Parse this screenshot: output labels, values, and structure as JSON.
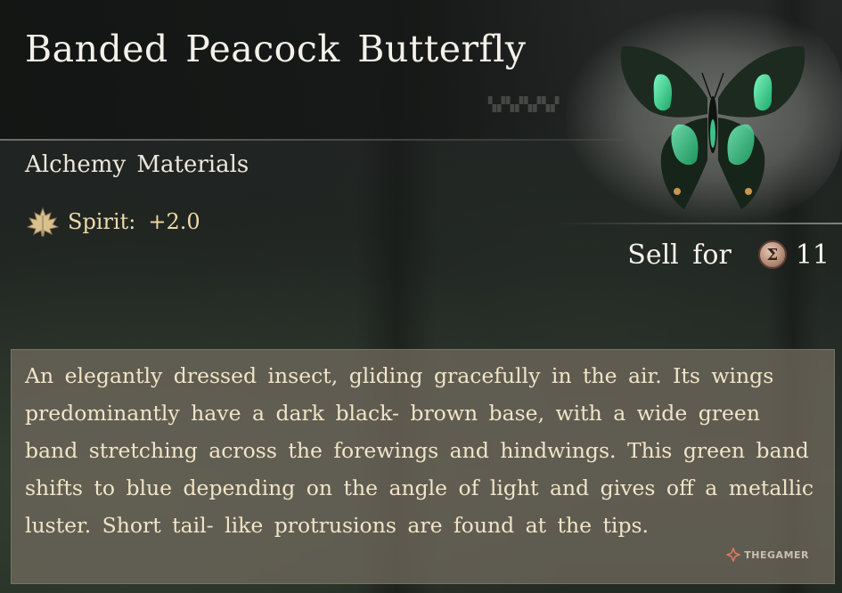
{
  "item": {
    "name": "Banded Peacock Butterfly",
    "category": "Alchemy Materials",
    "stat": {
      "label": "Spirit:",
      "value": "+2.0",
      "icon": "maple-leaf-icon"
    },
    "sell": {
      "label": "Sell for",
      "currency_icon": "coin-icon",
      "price": "11"
    },
    "description": "An elegantly dressed insect, gliding gracefully in the air. Its wings predominantly have a dark black- brown base, with a wide green band stretching across the forewings and hindwings. This green band shifts to blue depending on the angle of light and gives off a metallic luster. Short tail- like protrusions are found at the tips."
  },
  "watermark": {
    "text": "THEGAMER"
  },
  "colors": {
    "stat_text": "#f0d9a8",
    "description_text": "#f1e4c8",
    "butterfly_green": "#3ee08e"
  }
}
